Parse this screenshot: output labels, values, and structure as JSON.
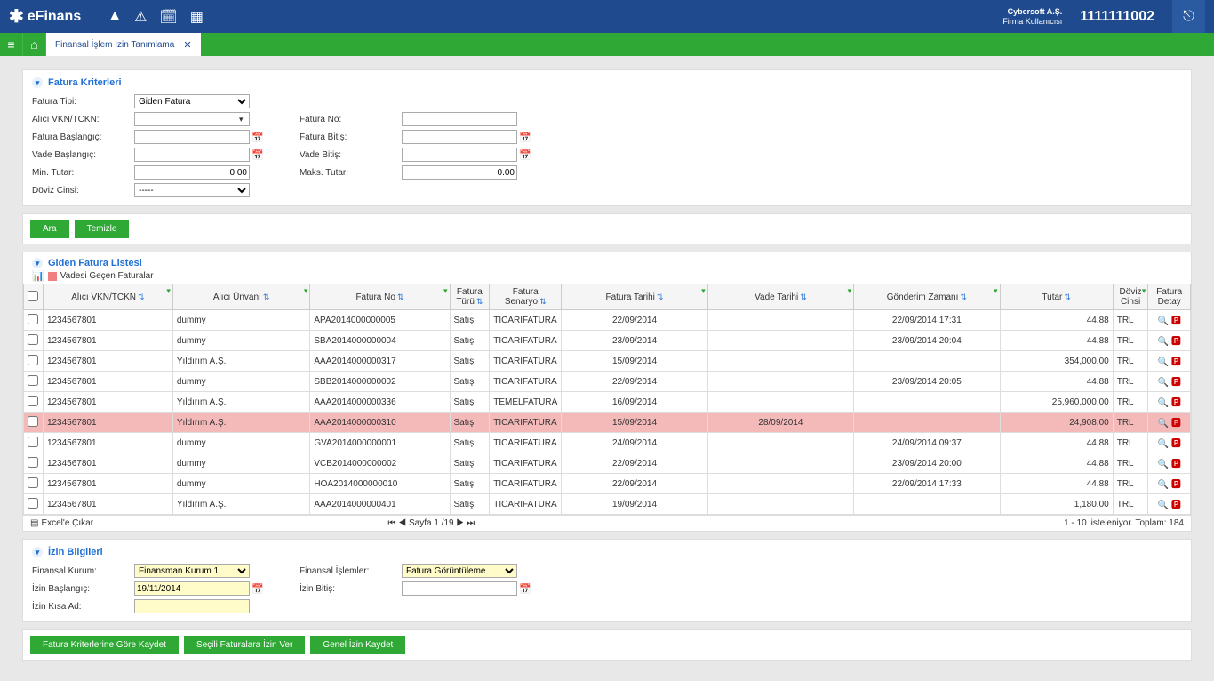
{
  "header": {
    "brand": "eFinans",
    "company_name": "Cybersoft A.Ş.",
    "role": "Firma Kullanıcısı",
    "user_number": "1111111002"
  },
  "tab": {
    "title": "Finansal İşlem İzin Tanımlama"
  },
  "criteria": {
    "panel_title": "Fatura Kriterleri",
    "fatura_tipi_label": "Fatura Tipi:",
    "fatura_tipi_value": "Giden Fatura",
    "alici_vkn_label": "Alıcı VKN/TCKN:",
    "fatura_baslangic_label": "Fatura Başlangıç:",
    "vade_baslangic_label": "Vade Başlangıç:",
    "min_tutar_label": "Min. Tutar:",
    "min_tutar_value": "0.00",
    "doviz_cinsi_label": "Döviz Cinsi:",
    "doviz_cinsi_value": "-----",
    "fatura_no_label": "Fatura No:",
    "fatura_bitis_label": "Fatura Bitiş:",
    "vade_bitis_label": "Vade Bitiş:",
    "maks_tutar_label": "Maks. Tutar:",
    "maks_tutar_value": "0.00"
  },
  "buttons": {
    "ara": "Ara",
    "temizle": "Temizle",
    "kriter_kaydet": "Fatura Kriterlerine Göre Kaydet",
    "secili_izin": "Seçili Faturalara İzin Ver",
    "genel_izin": "Genel İzin Kaydet"
  },
  "list": {
    "title": "Giden Fatura Listesi",
    "legend": "Vadesi Geçen Faturalar",
    "columns": {
      "vkn": "Alıcı VKN/TCKN",
      "unvan": "Alıcı Ünvanı",
      "fatura_no": "Fatura No",
      "turu": "Fatura Türü",
      "senaryo": "Fatura Senaryo",
      "tarih": "Fatura Tarihi",
      "vade": "Vade Tarihi",
      "gonderim": "Gönderim Zamanı",
      "tutar": "Tutar",
      "doviz": "Döviz Cinsi",
      "detay": "Fatura Detay"
    },
    "rows": [
      {
        "vkn": "1234567801",
        "unvan": "dummy",
        "no": "APA2014000000005",
        "turu": "Satış",
        "senaryo": "TICARIFATURA",
        "tarih": "22/09/2014",
        "vade": "",
        "gonderim": "22/09/2014 17:31",
        "tutar": "44.88",
        "doviz": "TRL",
        "overdue": false
      },
      {
        "vkn": "1234567801",
        "unvan": "dummy",
        "no": "SBA2014000000004",
        "turu": "Satış",
        "senaryo": "TICARIFATURA",
        "tarih": "23/09/2014",
        "vade": "",
        "gonderim": "23/09/2014 20:04",
        "tutar": "44.88",
        "doviz": "TRL",
        "overdue": false
      },
      {
        "vkn": "1234567801",
        "unvan": "Yıldırım A.Ş.",
        "no": "AAA2014000000317",
        "turu": "Satış",
        "senaryo": "TICARIFATURA",
        "tarih": "15/09/2014",
        "vade": "",
        "gonderim": "",
        "tutar": "354,000.00",
        "doviz": "TRL",
        "overdue": false
      },
      {
        "vkn": "1234567801",
        "unvan": "dummy",
        "no": "SBB2014000000002",
        "turu": "Satış",
        "senaryo": "TICARIFATURA",
        "tarih": "22/09/2014",
        "vade": "",
        "gonderim": "23/09/2014 20:05",
        "tutar": "44.88",
        "doviz": "TRL",
        "overdue": false
      },
      {
        "vkn": "1234567801",
        "unvan": "Yıldırım A.Ş.",
        "no": "AAA2014000000336",
        "turu": "Satış",
        "senaryo": "TEMELFATURA",
        "tarih": "16/09/2014",
        "vade": "",
        "gonderim": "",
        "tutar": "25,960,000.00",
        "doviz": "TRL",
        "overdue": false
      },
      {
        "vkn": "1234567801",
        "unvan": "Yıldırım A.Ş.",
        "no": "AAA2014000000310",
        "turu": "Satış",
        "senaryo": "TICARIFATURA",
        "tarih": "15/09/2014",
        "vade": "28/09/2014",
        "gonderim": "",
        "tutar": "24,908.00",
        "doviz": "TRL",
        "overdue": true
      },
      {
        "vkn": "1234567801",
        "unvan": "dummy",
        "no": "GVA2014000000001",
        "turu": "Satış",
        "senaryo": "TICARIFATURA",
        "tarih": "24/09/2014",
        "vade": "",
        "gonderim": "24/09/2014 09:37",
        "tutar": "44.88",
        "doviz": "TRL",
        "overdue": false
      },
      {
        "vkn": "1234567801",
        "unvan": "dummy",
        "no": "VCB2014000000002",
        "turu": "Satış",
        "senaryo": "TICARIFATURA",
        "tarih": "22/09/2014",
        "vade": "",
        "gonderim": "23/09/2014 20:00",
        "tutar": "44.88",
        "doviz": "TRL",
        "overdue": false
      },
      {
        "vkn": "1234567801",
        "unvan": "dummy",
        "no": "HOA2014000000010",
        "turu": "Satış",
        "senaryo": "TICARIFATURA",
        "tarih": "22/09/2014",
        "vade": "",
        "gonderim": "22/09/2014 17:33",
        "tutar": "44.88",
        "doviz": "TRL",
        "overdue": false
      },
      {
        "vkn": "1234567801",
        "unvan": "Yıldırım A.Ş.",
        "no": "AAA2014000000401",
        "turu": "Satış",
        "senaryo": "TICARIFATURA",
        "tarih": "19/09/2014",
        "vade": "",
        "gonderim": "",
        "tutar": "1,180.00",
        "doviz": "TRL",
        "overdue": false
      }
    ],
    "excel": "Excel'e Çıkar",
    "pager": "Sayfa 1 /19",
    "total": "1 - 10 listeleniyor. Toplam: 184"
  },
  "izin": {
    "title": "İzin Bilgileri",
    "kurum_label": "Finansal Kurum:",
    "kurum_value": "Finansman Kurum 1",
    "islem_label": "Finansal İşlemler:",
    "islem_value": "Fatura Görüntüleme",
    "baslangic_label": "İzin Başlangıç:",
    "baslangic_value": "19/11/2014",
    "bitis_label": "İzin Bitiş:",
    "kisa_ad_label": "İzin Kısa Ad:"
  }
}
